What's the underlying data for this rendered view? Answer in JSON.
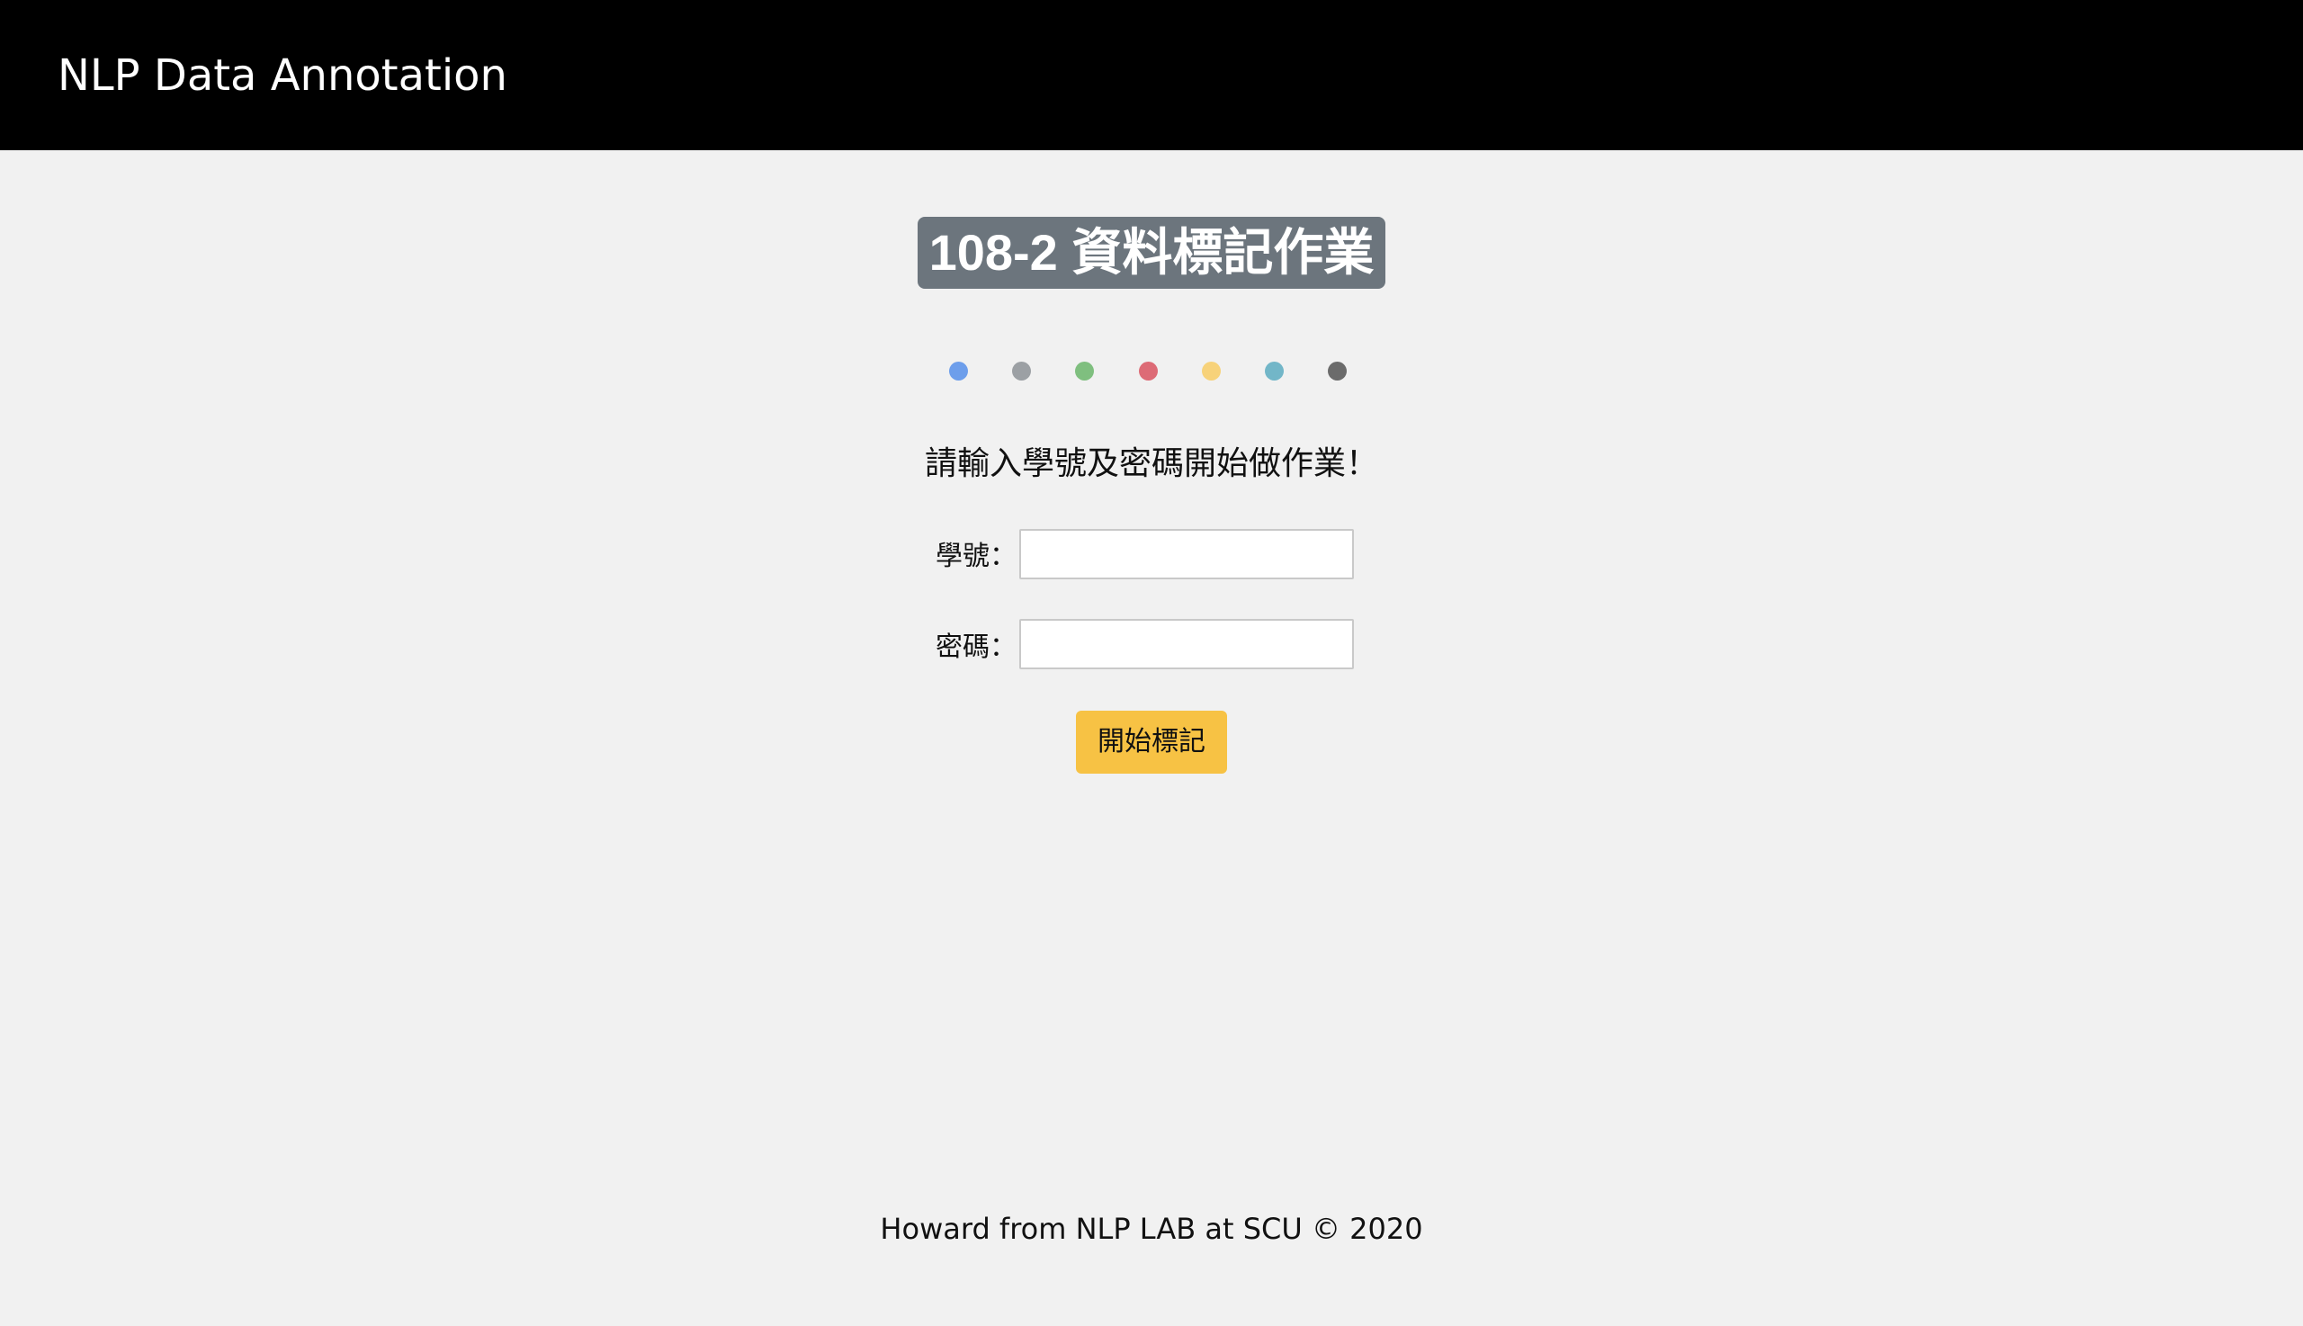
{
  "navbar": {
    "brand": "NLP Data Annotation"
  },
  "main": {
    "title": "108-2 資料標記作業",
    "dots": [
      {
        "name": "blue-dot",
        "color": "#6d9eeb"
      },
      {
        "name": "gray-dot",
        "color": "#9ca0a4"
      },
      {
        "name": "green-dot",
        "color": "#7fbf7f"
      },
      {
        "name": "red-dot",
        "color": "#dd6b76"
      },
      {
        "name": "yellow-dot",
        "color": "#f7d27a"
      },
      {
        "name": "cyan-dot",
        "color": "#72b6c8"
      },
      {
        "name": "dark-gray-dot",
        "color": "#6b6b6b"
      }
    ],
    "prompt": "請輸入學號及密碼開始做作業！",
    "student_id": {
      "label": "學號：",
      "value": "",
      "placeholder": ""
    },
    "password": {
      "label": "密碼：",
      "value": "",
      "placeholder": ""
    },
    "start_button": "開始標記"
  },
  "footer": {
    "text": "Howard from NLP LAB at SCU © 2020"
  },
  "colors": {
    "navbar_bg": "#000000",
    "page_bg": "#f1f1f1",
    "badge_bg": "#6c757d",
    "button_bg": "#f7c244"
  }
}
